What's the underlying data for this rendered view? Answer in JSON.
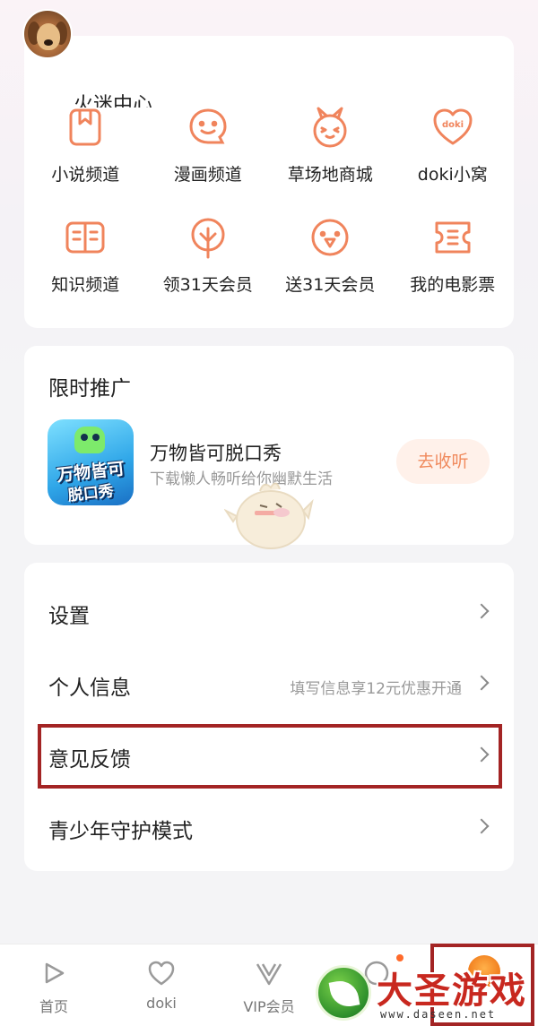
{
  "header": {
    "section_title_partial": "火迷中心"
  },
  "functions": {
    "items": [
      {
        "label": "小说频道",
        "icon": "bookmark-book-icon"
      },
      {
        "label": "漫画频道",
        "icon": "speech-bubble-face-icon"
      },
      {
        "label": "草场地商城",
        "icon": "bunny-face-icon"
      },
      {
        "label": "doki小窝",
        "icon": "doki-heart-icon"
      },
      {
        "label": "知识频道",
        "icon": "open-book-icon"
      },
      {
        "label": "领31天会员",
        "icon": "tree-leaf-icon"
      },
      {
        "label": "送31天会员",
        "icon": "bird-face-icon"
      },
      {
        "label": "我的电影票",
        "icon": "ticket-icon"
      }
    ]
  },
  "promo": {
    "title": "限时推广",
    "app_icon_text_1": "万物皆可",
    "app_icon_text_2": "脱口秀",
    "name": "万物皆可脱口秀",
    "description": "下载懒人畅听给你幽默生活",
    "button": "去收听"
  },
  "settings": {
    "rows": [
      {
        "label": "设置",
        "hint": ""
      },
      {
        "label": "个人信息",
        "hint": "填写信息享12元优惠开通"
      },
      {
        "label": "意见反馈",
        "hint": ""
      },
      {
        "label": "青少年守护模式",
        "hint": ""
      }
    ]
  },
  "tabbar": {
    "tabs": [
      {
        "label": "首页"
      },
      {
        "label": "doki"
      },
      {
        "label": "VIP会员"
      }
    ]
  },
  "watermark": {
    "name": "大圣游戏网",
    "url": "www.daseen.net"
  },
  "colors": {
    "icon_accent": "#f0845c",
    "highlight_border": "#a32424",
    "button_bg": "#fff1ea",
    "button_text": "#f08a5d",
    "hint_text": "#999999"
  }
}
